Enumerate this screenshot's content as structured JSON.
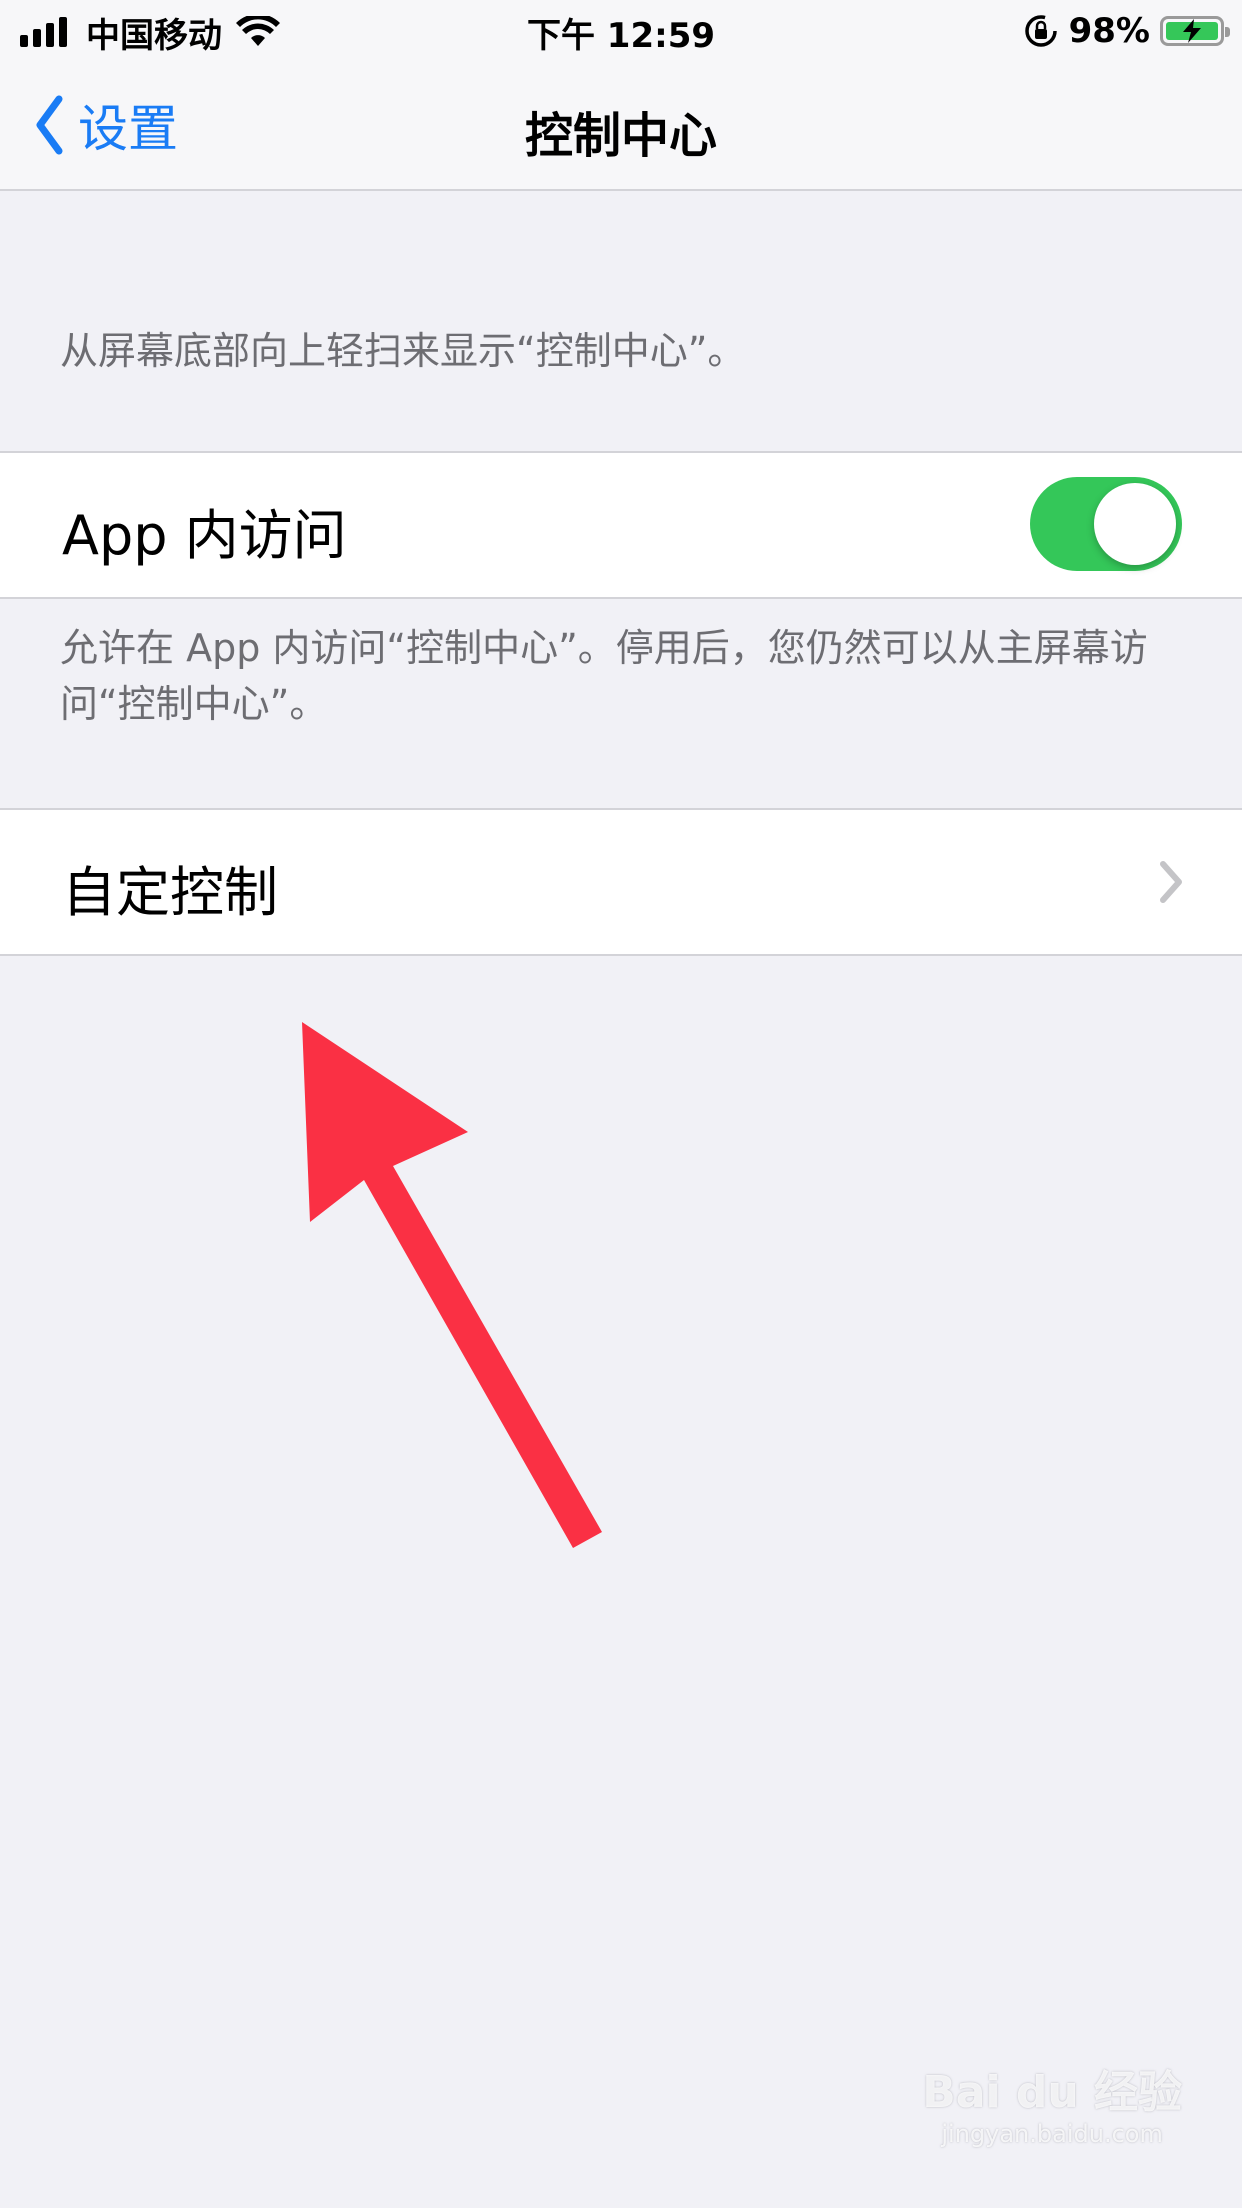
{
  "status_bar": {
    "carrier": "中国移动",
    "time": "下午 12:59",
    "battery_percent": "98%",
    "icons": [
      "signal-icon",
      "wifi-icon",
      "orientation-lock-icon",
      "battery-charging-icon"
    ],
    "battery_color": "#35c759"
  },
  "nav": {
    "back_label": "设置",
    "title": "控制中心",
    "accent_color": "#1a7cf5"
  },
  "main": {
    "intro": "从屏幕底部向上轻扫来显示“控制中心”。",
    "access_in_apps": {
      "label": "App 内访问",
      "enabled": true,
      "toggle_color": "#34c759"
    },
    "access_footer": "允许在 App 内访问“控制中心”。停用后，您仍然可以从主屏幕访问“控制中心”。",
    "customize": {
      "label": "自定控制"
    }
  },
  "annotation": {
    "arrow_color": "#fa3044"
  },
  "watermark": {
    "brand": "Bai du 经验",
    "url": "jingyan.baidu.com"
  }
}
